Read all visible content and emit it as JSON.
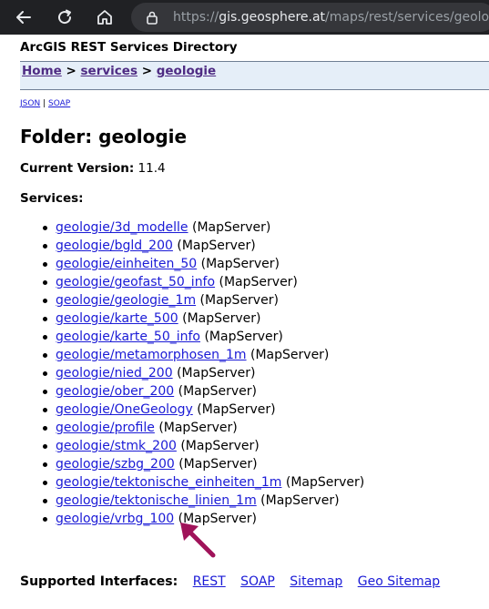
{
  "browser": {
    "url_protocol": "https://",
    "url_host": "gis.geosphere.at",
    "url_path": "/maps/rest/services/geologie"
  },
  "page": {
    "directory_title": "ArcGIS REST Services Directory",
    "breadcrumb": {
      "home": "Home",
      "services": "services",
      "geologie": "geologie",
      "separator": ">"
    },
    "formats": {
      "json": "JSON",
      "divider": "|",
      "soap": "SOAP"
    },
    "folder_title": "Folder: geologie",
    "version_label": "Current Version:",
    "version_value": "11.4",
    "services_label": "Services:",
    "services": [
      {
        "name": "geologie/3d_modelle",
        "type": "(MapServer)"
      },
      {
        "name": "geologie/bgld_200",
        "type": "(MapServer)"
      },
      {
        "name": "geologie/einheiten_50",
        "type": "(MapServer)"
      },
      {
        "name": "geologie/geofast_50_info",
        "type": "(MapServer)"
      },
      {
        "name": "geologie/geologie_1m",
        "type": "(MapServer)"
      },
      {
        "name": "geologie/karte_500",
        "type": "(MapServer)"
      },
      {
        "name": "geologie/karte_50_info",
        "type": "(MapServer)"
      },
      {
        "name": "geologie/metamorphosen_1m",
        "type": "(MapServer)"
      },
      {
        "name": "geologie/nied_200",
        "type": "(MapServer)"
      },
      {
        "name": "geologie/ober_200",
        "type": "(MapServer)"
      },
      {
        "name": "geologie/OneGeology",
        "type": "(MapServer)"
      },
      {
        "name": "geologie/profile",
        "type": "(MapServer)"
      },
      {
        "name": "geologie/stmk_200",
        "type": "(MapServer)"
      },
      {
        "name": "geologie/szbg_200",
        "type": "(MapServer)"
      },
      {
        "name": "geologie/tektonische_einheiten_1m",
        "type": "(MapServer)"
      },
      {
        "name": "geologie/tektonische_linien_1m",
        "type": "(MapServer)"
      },
      {
        "name": "geologie/vrbg_100",
        "type": "(MapServer)"
      }
    ],
    "interfaces_label": "Supported Interfaces:",
    "interfaces": [
      "REST",
      "SOAP",
      "Sitemap",
      "Geo Sitemap"
    ]
  },
  "annotation": {
    "arrow_color": "#a0135a",
    "icon": "pointer-arrow-icon"
  }
}
